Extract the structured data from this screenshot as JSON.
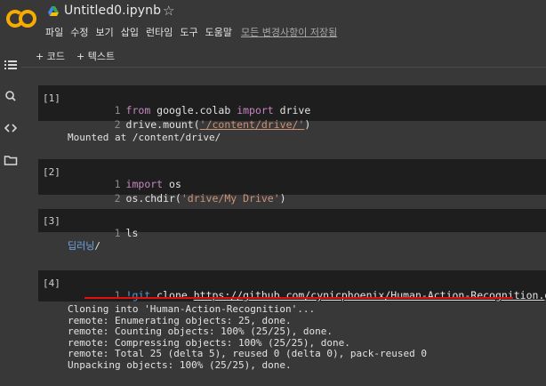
{
  "header": {
    "logo_text": "CO",
    "title": "Untitled0.ipynb",
    "menu": [
      "파일",
      "수정",
      "보기",
      "삽입",
      "런타임",
      "도구",
      "도움말"
    ],
    "save_status": "모든 변경사항이 저장됨"
  },
  "toolbar": {
    "add_code": "+ 코드",
    "add_text": "+ 텍스트"
  },
  "cells": [
    {
      "prompt": "[1]",
      "lines": [
        {
          "n": "1",
          "parts": [
            [
              "kw",
              "from"
            ],
            [
              "t",
              " google.colab "
            ],
            [
              "kw",
              "import"
            ],
            [
              "t",
              " drive"
            ]
          ]
        },
        {
          "n": "2",
          "parts": [
            [
              "t",
              "drive.mount("
            ],
            [
              "str",
              "'/content/drive/'"
            ],
            [
              "t",
              ")"
            ]
          ]
        }
      ],
      "output": "Mounted at /content/drive/"
    },
    {
      "prompt": "[2]",
      "lines": [
        {
          "n": "1",
          "parts": [
            [
              "kw",
              "import"
            ],
            [
              "t",
              " os"
            ]
          ]
        },
        {
          "n": "2",
          "parts": [
            [
              "t",
              "os.chdir("
            ],
            [
              "str",
              "'drive/My Drive'"
            ],
            [
              "t",
              ")"
            ]
          ]
        }
      ]
    },
    {
      "prompt": "[3]",
      "lines": [
        {
          "n": "1",
          "parts": [
            [
              "t",
              "ls"
            ]
          ]
        }
      ],
      "output_link": "딥러닝",
      "output_suffix": "/"
    },
    {
      "prompt": "[4]",
      "lines": [
        {
          "n": "1",
          "parts": [
            [
              "bang",
              "!git"
            ],
            [
              "t",
              " clone "
            ],
            [
              "url",
              "https://github.com/cynicphoenix/Human-Action-Recognition.git"
            ]
          ]
        }
      ],
      "output_lines": [
        "Cloning into 'Human-Action-Recognition'...",
        "remote: Enumerating objects: 25, done.",
        "remote: Counting objects: 100% (25/25), done.",
        "remote: Compressing objects: 100% (25/25), done.",
        "remote: Total 25 (delta 5), reused 0 (delta 0), pack-reused 0",
        "Unpacking objects: 100% (25/25), done."
      ]
    }
  ],
  "colors": {
    "background": "#383838",
    "cell": "#1e1e1e",
    "keyword": "#c586c0",
    "string": "#ce9178",
    "link": "#6ea6e6",
    "highlight": "#e01010"
  },
  "icons": [
    "colab-logo",
    "drive-icon",
    "star-icon",
    "toc-icon",
    "search-icon",
    "code-icon",
    "folder-icon"
  ]
}
